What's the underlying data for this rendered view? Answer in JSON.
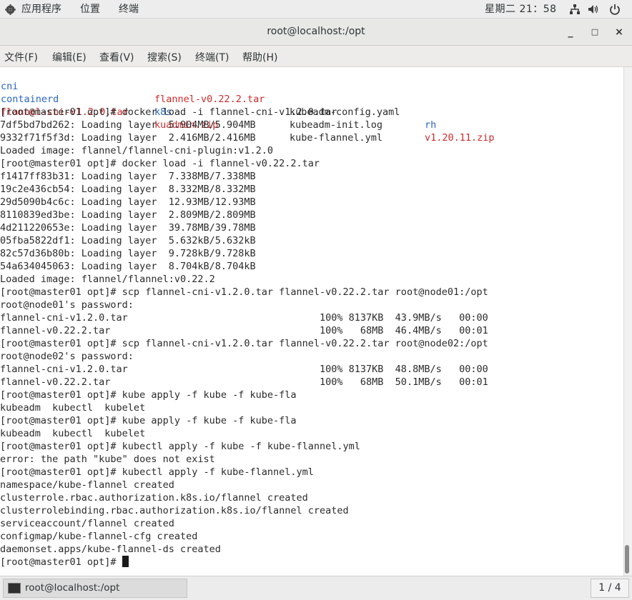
{
  "topbar": {
    "apps": "应用程序",
    "places": "位置",
    "terminal": "终端",
    "clock": "星期二 21：58",
    "icons": [
      "network-icon",
      "volume-icon",
      "power-icon"
    ]
  },
  "window": {
    "title": "root@localhost:/opt",
    "minimize": "_",
    "maximize": "□",
    "close": "×"
  },
  "menu": {
    "file": "文件(F)",
    "edit": "编辑(E)",
    "view": "查看(V)",
    "search": "搜索(S)",
    "terminal": "终端(T)",
    "help": "帮助(H)"
  },
  "listing": {
    "row1": {
      "c1": "cni",
      "c2": "flannel-v0.22.2.tar",
      "c3": "kubeadm-config.yaml",
      "c4": "rh"
    },
    "row2": {
      "c1": "containerd",
      "c2": "k8s",
      "c3": "kubeadm-init.log",
      "c4": "v1.20.11.zip"
    },
    "row3": {
      "c1": "flannel-cni-v1.2.0.tar",
      "c2": "kuadmin.zip",
      "c3": "kube-flannel.yml"
    }
  },
  "lines": [
    "[root@master01 opt]# docker load -i flannel-cni-v1.2.0.tar",
    "7df5bd7bd262: Loading layer  5.904MB/5.904MB",
    "9332f71f5f3d: Loading layer  2.416MB/2.416MB",
    "Loaded image: flannel/flannel-cni-plugin:v1.2.0",
    "[root@master01 opt]# docker load -i flannel-v0.22.2.tar",
    "f1417ff83b31: Loading layer  7.338MB/7.338MB",
    "19c2e436cb54: Loading layer  8.332MB/8.332MB",
    "29d5090b4c6c: Loading layer  12.93MB/12.93MB",
    "8110839ed3be: Loading layer  2.809MB/2.809MB",
    "4d211220653e: Loading layer  39.78MB/39.78MB",
    "05fba5822df1: Loading layer  5.632kB/5.632kB",
    "82c57d36b80b: Loading layer  9.728kB/9.728kB",
    "54a634045063: Loading layer  8.704kB/8.704kB",
    "Loaded image: flannel/flannel:v0.22.2",
    "[root@master01 opt]# scp flannel-cni-v1.2.0.tar flannel-v0.22.2.tar root@node01:/opt",
    "root@node01's password:",
    "flannel-cni-v1.2.0.tar                                 100% 8137KB  43.9MB/s   00:00",
    "flannel-v0.22.2.tar                                    100%   68MB  46.4MB/s   00:01",
    "[root@master01 opt]# scp flannel-cni-v1.2.0.tar flannel-v0.22.2.tar root@node02:/opt",
    "root@node02's password:",
    "flannel-cni-v1.2.0.tar                                 100% 8137KB  48.8MB/s   00:00",
    "flannel-v0.22.2.tar                                    100%   68MB  50.1MB/s   00:01",
    "[root@master01 opt]# kube apply -f kube -f kube-fla",
    "kubeadm  kubectl  kubelet",
    "[root@master01 opt]# kube apply -f kube -f kube-fla",
    "kubeadm  kubectl  kubelet",
    "[root@master01 opt]# kubectl apply -f kube -f kube-flannel.yml",
    "error: the path \"kube\" does not exist",
    "[root@master01 opt]# kubectl apply -f kube-flannel.yml",
    "namespace/kube-flannel created",
    "clusterrole.rbac.authorization.k8s.io/flannel created",
    "clusterrolebinding.rbac.authorization.k8s.io/flannel created",
    "serviceaccount/flannel created",
    "configmap/kube-flannel-cfg created",
    "daemonset.apps/kube-flannel-ds created"
  ],
  "prompt": "[root@master01 opt]# ",
  "colors": {
    "directory": "#2a65c8",
    "archive": "#d02b2b"
  },
  "taskbar": {
    "window_label": "root@localhost:/opt",
    "workspace": "1 / 4"
  }
}
